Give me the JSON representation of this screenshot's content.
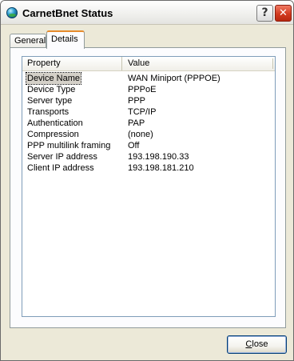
{
  "window": {
    "title": "CarnetBnet Status",
    "help_label": "?",
    "close_label": "✕"
  },
  "tabs": [
    {
      "label": "General",
      "active": false
    },
    {
      "label": "Details",
      "active": true
    }
  ],
  "list": {
    "columns": [
      "Property",
      "Value"
    ],
    "rows": [
      {
        "property": "Device Name",
        "value": "WAN Miniport (PPPOE)",
        "selected": true
      },
      {
        "property": "Device Type",
        "value": "PPPoE"
      },
      {
        "property": "Server type",
        "value": "PPP"
      },
      {
        "property": "Transports",
        "value": "TCP/IP"
      },
      {
        "property": "Authentication",
        "value": "PAP"
      },
      {
        "property": "Compression",
        "value": "(none)"
      },
      {
        "property": "PPP multilink framing",
        "value": "Off"
      },
      {
        "property": "Server IP address",
        "value": "193.198.190.33"
      },
      {
        "property": "Client IP address",
        "value": "193.198.181.210"
      }
    ]
  },
  "footer": {
    "close_button_label": "Close"
  },
  "colors": {
    "window_bg": "#ece9d8",
    "active_tab_accent": "#e68b2c",
    "close_red": "#d23a1f",
    "selection_bg": "#d4d0c8"
  }
}
